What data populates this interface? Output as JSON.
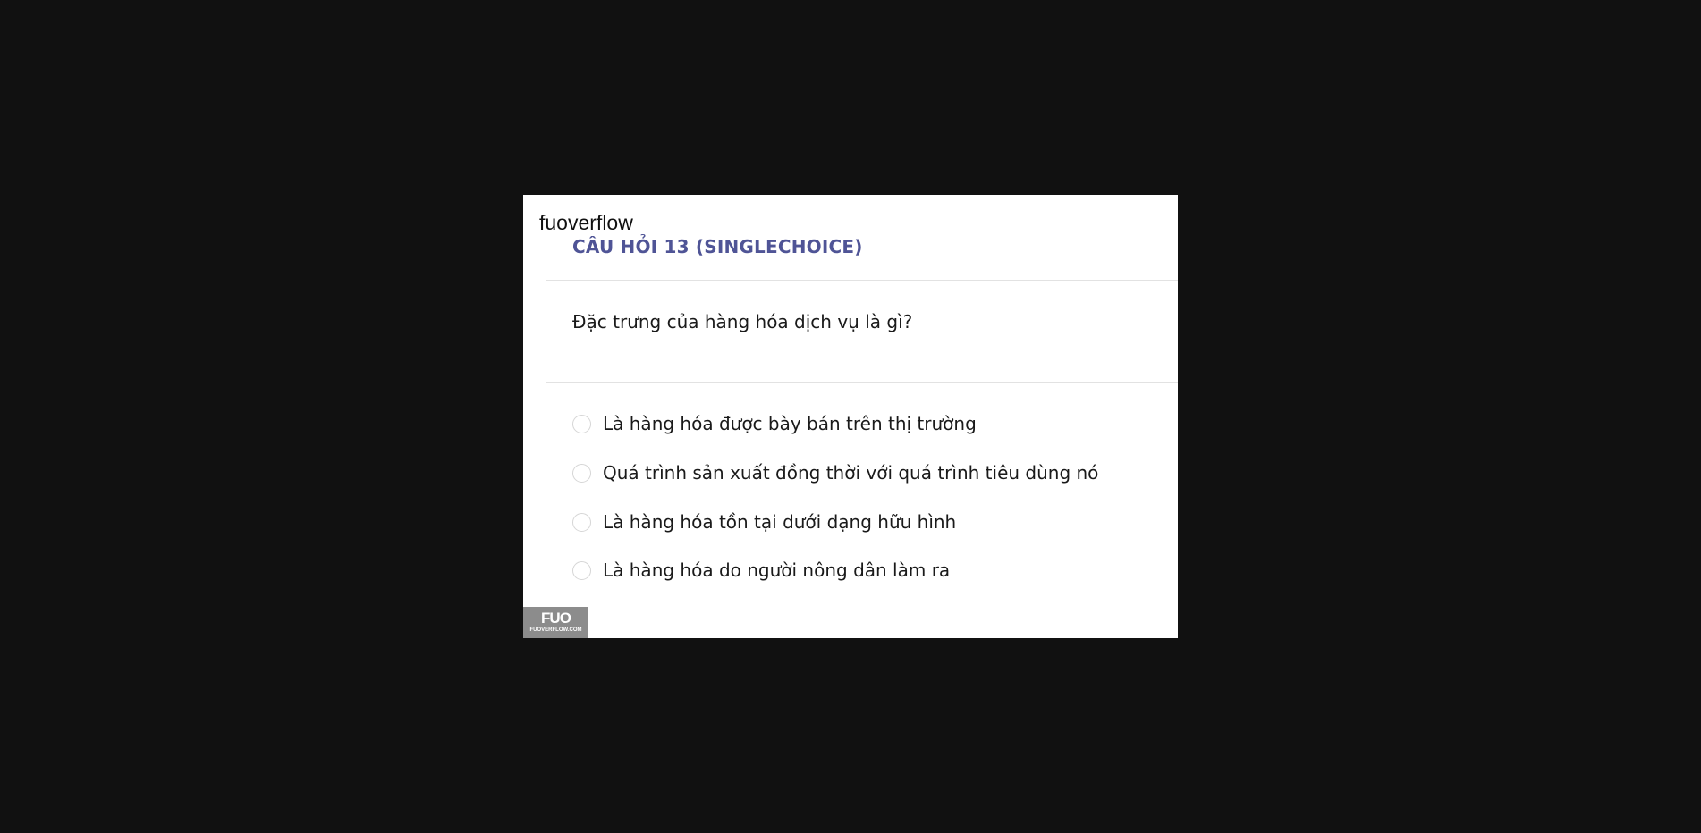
{
  "brand": "fuoverflow",
  "question": {
    "header": "CÂU HỎI 13 (SINGLECHOICE)",
    "text": "Đặc trưng của hàng hóa dịch vụ là gì?",
    "options": [
      {
        "label": "Là hàng hóa được bày bán trên thị trường"
      },
      {
        "label": "Quá trình sản xuất đồng thời với quá trình tiêu dùng nó"
      },
      {
        "label": "Là hàng hóa tồn tại dưới dạng hữu hình"
      },
      {
        "label": "Là hàng hóa do người nông dân làm ra"
      }
    ]
  },
  "watermark": {
    "mark": "FUO",
    "site": "FUOVERFLOW.COM"
  },
  "colors": {
    "background": "#111111",
    "card": "#ffffff",
    "header_accent": "#4f5496",
    "watermark_bg": "#8c8c8c"
  }
}
